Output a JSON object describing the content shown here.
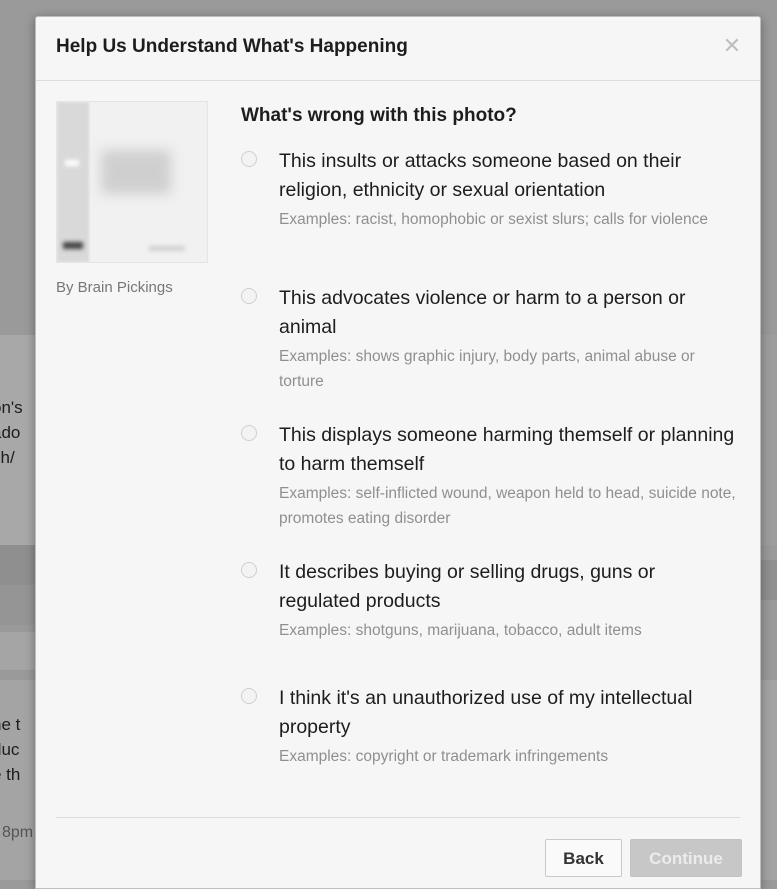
{
  "background": {
    "snippets": [
      "on's",
      "ado",
      "ch/",
      "ne t",
      "duc",
      "e th"
    ],
    "meta": "8pm"
  },
  "dialog": {
    "title": "Help Us Understand What's Happening",
    "close_icon": "close-icon",
    "thumbnail_caption": "By Brain Pickings",
    "question": "What's wrong with this photo?",
    "options": [
      {
        "label": "This insults or attacks someone based on their religion, ethnicity or sexual orientation",
        "example": "Examples: racist, homophobic or sexist slurs; calls for violence"
      },
      {
        "label": "This advocates violence or harm to a person or animal",
        "example": "Examples: shows graphic injury, body parts, animal abuse or torture"
      },
      {
        "label": "This displays someone harming themself or planning to harm themself",
        "example": "Examples: self-inflicted wound, weapon held to head, suicide note, promotes eating disorder"
      },
      {
        "label": "It describes buying or selling drugs, guns or regulated products",
        "example": "Examples: shotguns, marijuana, tobacco, adult items"
      },
      {
        "label": "I think it's an unauthorized use of my intellectual property",
        "example": "Examples: copyright or trademark infringements"
      }
    ],
    "buttons": {
      "back": "Back",
      "continue": "Continue"
    }
  }
}
